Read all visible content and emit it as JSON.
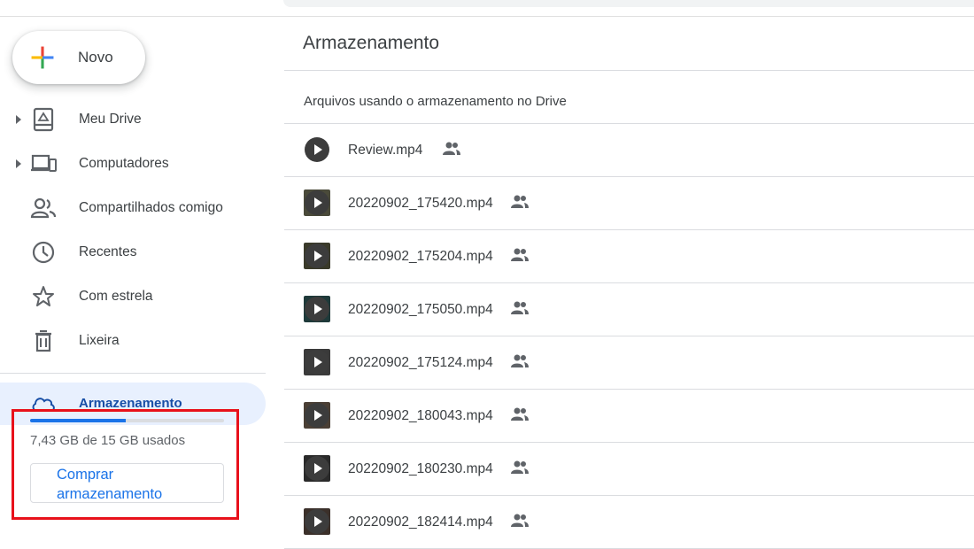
{
  "sidebar": {
    "new_button": "Novo",
    "items": [
      {
        "label": "Meu Drive",
        "icon": "drive-icon",
        "expandable": true
      },
      {
        "label": "Computadores",
        "icon": "computers-icon",
        "expandable": true
      },
      {
        "label": "Compartilhados comigo",
        "icon": "shared-people-icon",
        "expandable": false
      },
      {
        "label": "Recentes",
        "icon": "clock-icon",
        "expandable": false
      },
      {
        "label": "Com estrela",
        "icon": "star-icon",
        "expandable": false
      },
      {
        "label": "Lixeira",
        "icon": "trash-icon",
        "expandable": false
      }
    ],
    "storage": {
      "label": "Armazenamento",
      "icon": "cloud-icon",
      "usage_text": "7,43 GB de 15 GB usados",
      "used_fraction": 0.495,
      "buy_button": "Comprar armazenamento"
    }
  },
  "main": {
    "title": "Armazenamento",
    "section_header": "Arquivos usando o armazenamento no Drive",
    "files": [
      {
        "name": "Review.mp4",
        "thumb": "play-icon"
      },
      {
        "name": "20220902_175420.mp4",
        "thumb": "video-thumbnail"
      },
      {
        "name": "20220902_175204.mp4",
        "thumb": "video-thumbnail"
      },
      {
        "name": "20220902_175050.mp4",
        "thumb": "video-thumbnail"
      },
      {
        "name": "20220902_175124.mp4",
        "thumb": "video-thumbnail"
      },
      {
        "name": "20220902_180043.mp4",
        "thumb": "video-thumbnail"
      },
      {
        "name": "20220902_180230.mp4",
        "thumb": "video-thumbnail"
      },
      {
        "name": "20220902_182414.mp4",
        "thumb": "video-thumbnail"
      }
    ]
  },
  "colors": {
    "accent": "#1a73e8",
    "active_bg": "#e8f0fe",
    "active_text": "#174ea6",
    "highlight": "#e8111b"
  }
}
